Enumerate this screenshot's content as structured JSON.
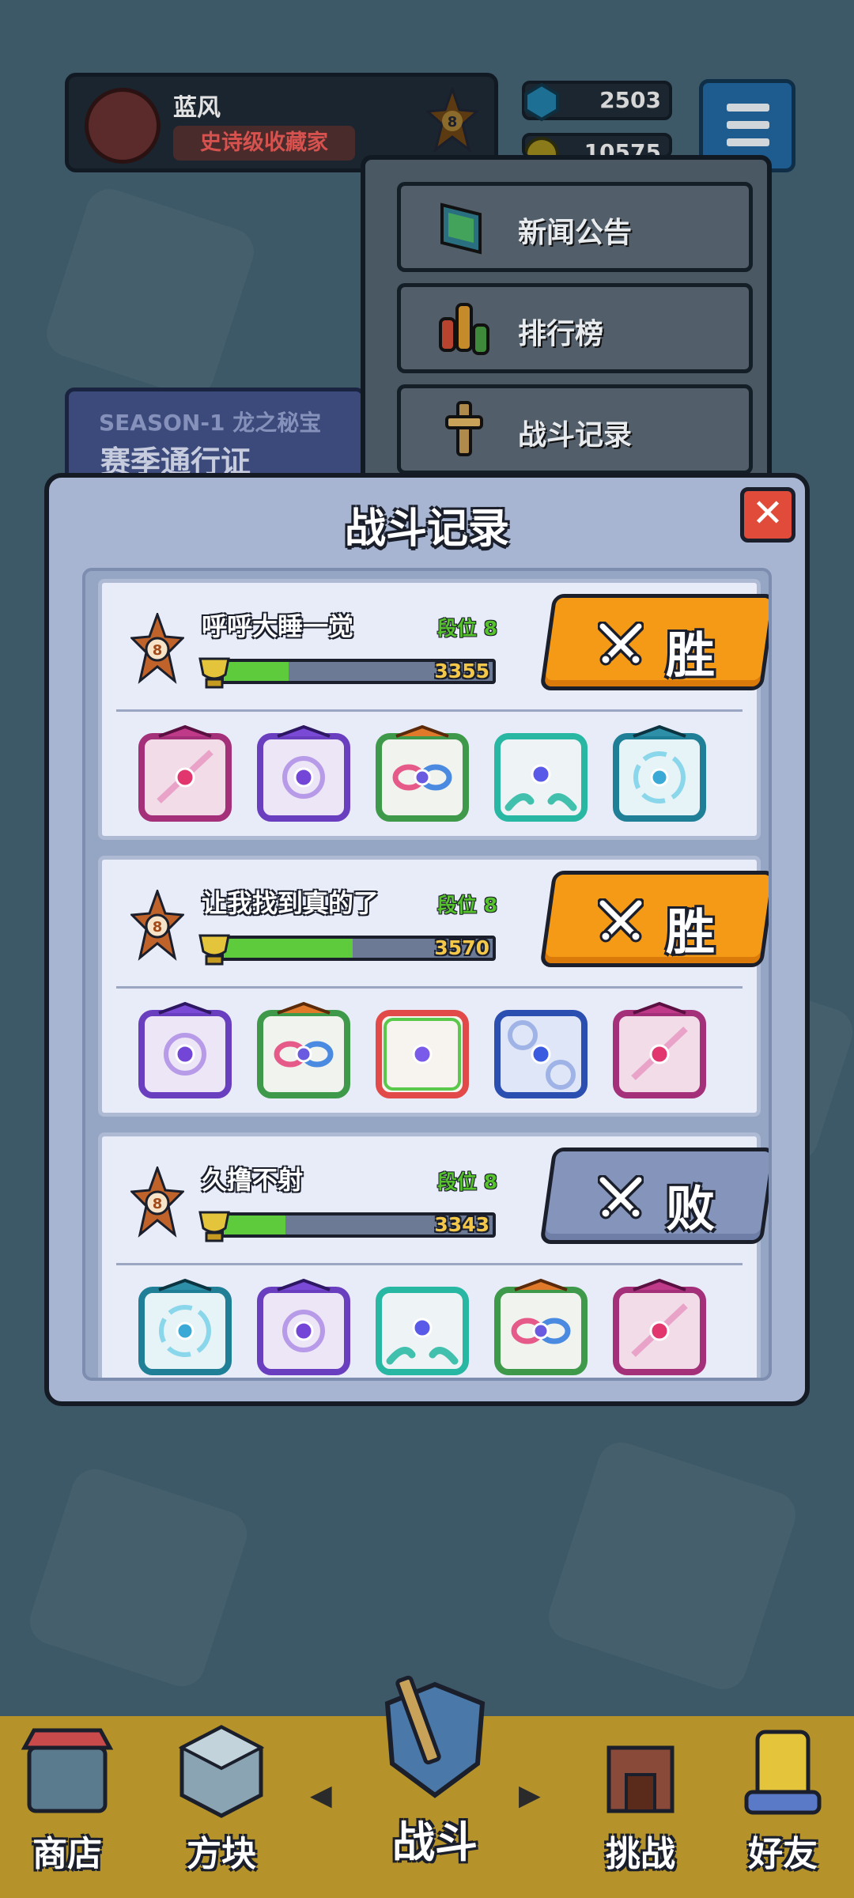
{
  "header": {
    "player_name": "蓝风",
    "player_title": "史诗级收藏家",
    "rank_level": "8",
    "gems": "2503",
    "coins": "10575"
  },
  "menu": {
    "items": [
      {
        "label": "新闻公告",
        "icon": "news-monitor-icon"
      },
      {
        "label": "排行榜",
        "icon": "leaderboard-bars-icon"
      },
      {
        "label": "战斗记录",
        "icon": "battle-record-sword-icon"
      }
    ]
  },
  "season": {
    "line1": "SEASON-1 龙之秘宝",
    "line2": "赛季通行证"
  },
  "modal": {
    "title": "战斗记录",
    "close_icon": "close-x-icon",
    "records": [
      {
        "opponent": "呼呼大睡一觉",
        "tier": "段位 8",
        "rank_badge": "8",
        "trophies": "3355",
        "trophy_progress": 0.24,
        "result": "胜",
        "outcome": "win",
        "dice": [
          "pink-dragon-sword-die",
          "purple-dragon-orb-die",
          "rainbow-dragon-infinity-die",
          "teal-hands-die",
          "cyan-dragon-vortex-die"
        ]
      },
      {
        "opponent": "让我找到真的了",
        "tier": "段位 8",
        "rank_badge": "8",
        "trophies": "3570",
        "trophy_progress": 0.48,
        "result": "胜",
        "outcome": "win",
        "dice": [
          "purple-dragon-orb-die",
          "rainbow-dragon-infinity-die",
          "rainbow-prism-die",
          "blue-gear-die",
          "pink-dragon-sword-die"
        ]
      },
      {
        "opponent": "久撸不射",
        "tier": "段位 8",
        "rank_badge": "8",
        "trophies": "3343",
        "trophy_progress": 0.23,
        "result": "败",
        "outcome": "lose",
        "dice": [
          "cyan-dragon-vortex-die",
          "purple-dragon-orb-die",
          "teal-hands-die",
          "rainbow-dragon-infinity-die",
          "pink-dragon-sword-die"
        ]
      }
    ]
  },
  "nav": {
    "items": [
      {
        "label": "商店",
        "icon": "shop-icon"
      },
      {
        "label": "方块",
        "icon": "dice-box-icon"
      },
      {
        "label": "战斗",
        "icon": "battle-shield-icon"
      },
      {
        "label": "挑战",
        "icon": "challenge-castle-icon"
      },
      {
        "label": "好友",
        "icon": "friends-icon"
      }
    ]
  },
  "colors": {
    "win": "#f59a16",
    "lose": "#8494bb",
    "modal_bg": "#a7b5d2",
    "progress": "#5dcb3b",
    "trophy_text": "#f3c84a",
    "tier_text": "#56c22c"
  }
}
